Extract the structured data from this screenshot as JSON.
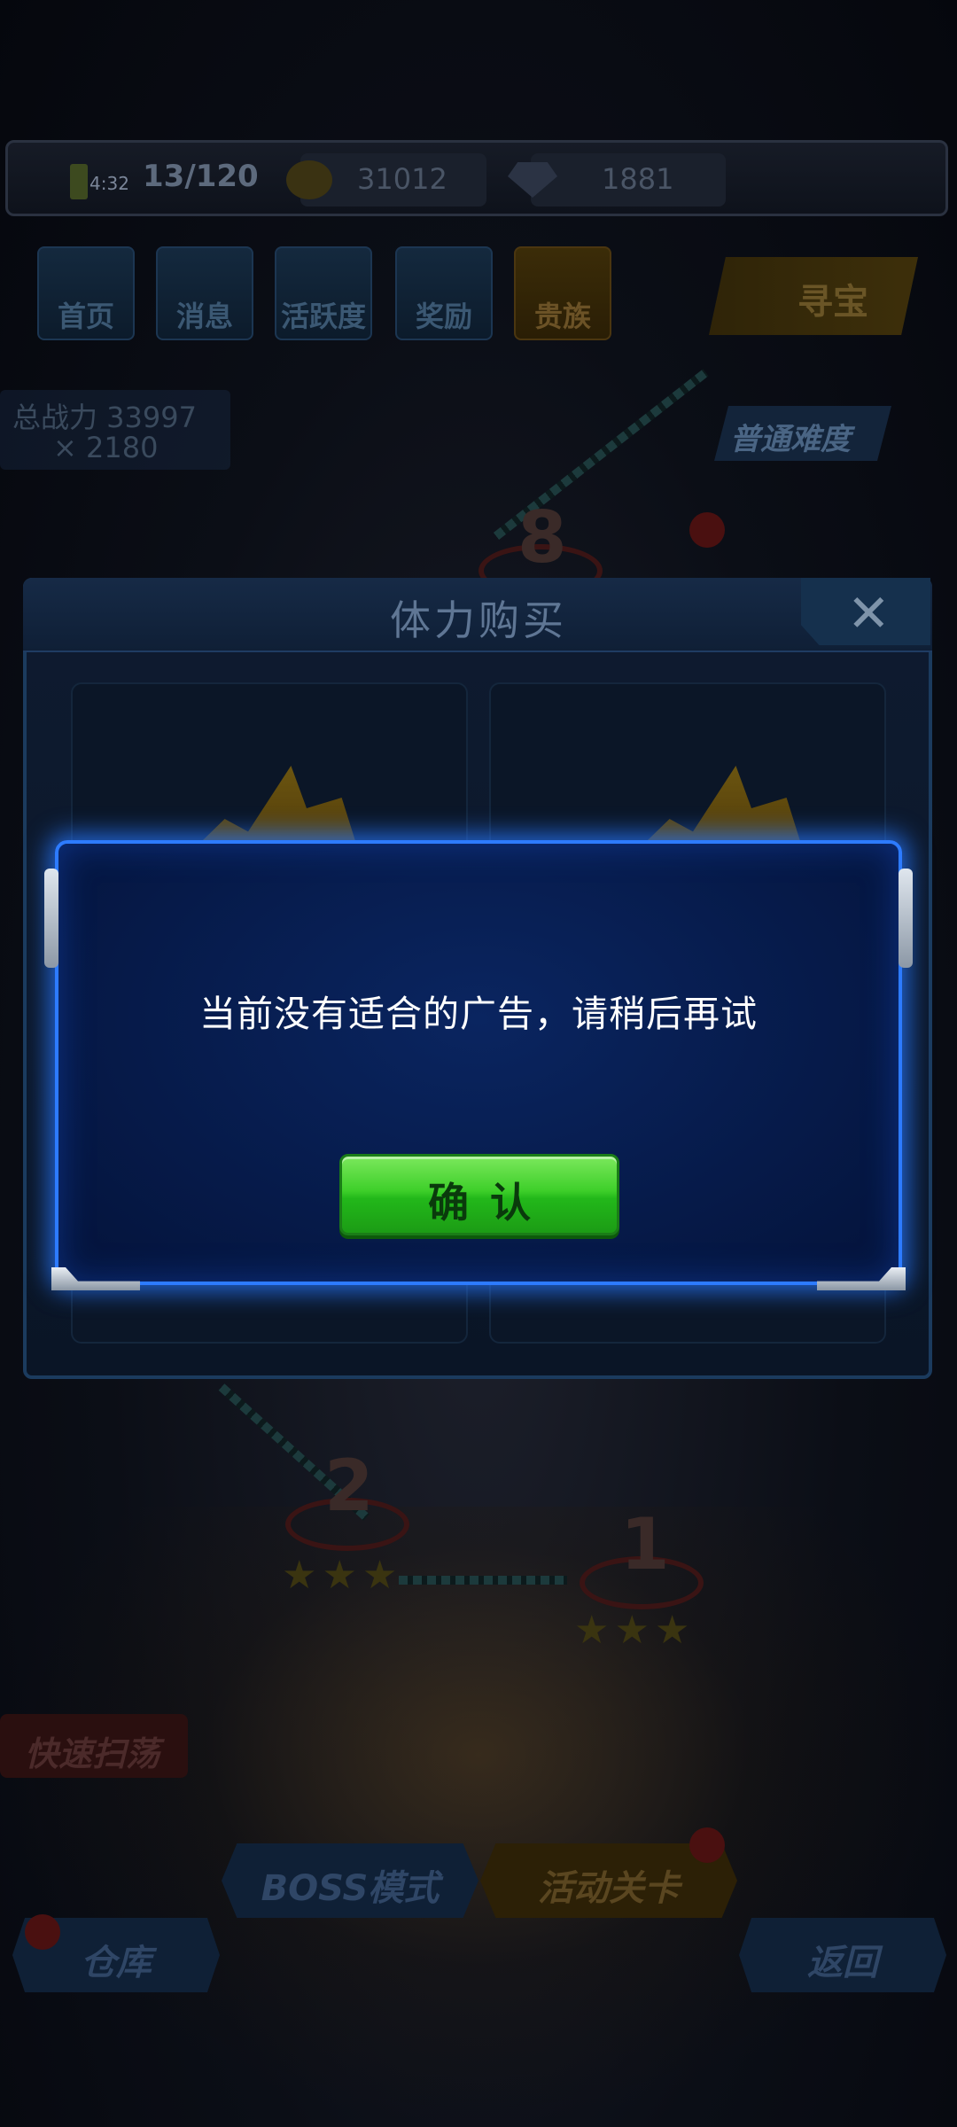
{
  "hud": {
    "time": "4:32",
    "stamina": "13/120",
    "gold": "31012",
    "diamonds": "1881"
  },
  "menu": {
    "items": [
      {
        "label": "首页"
      },
      {
        "label": "消息"
      },
      {
        "label": "活跃度"
      },
      {
        "label": "奖励"
      },
      {
        "label": "贵族"
      }
    ],
    "treasure_label": "寻宝"
  },
  "stats": {
    "total_power": "总战力 33997",
    "keys": "× 2180",
    "difficulty": "普通难度"
  },
  "stages": [
    {
      "number": "8"
    },
    {
      "number": "2"
    },
    {
      "number": "1"
    }
  ],
  "bottom": {
    "quick_sweep": "快速扫荡",
    "boss_mode": "BOSS模式",
    "event_stage": "活动关卡",
    "warehouse": "仓库",
    "back": "返回"
  },
  "purchase_panel": {
    "title": "体力购买",
    "close_icon": "close-icon"
  },
  "alert": {
    "message": "当前没有适合的广告，请稍后再试",
    "confirm_label": "确认"
  },
  "colors": {
    "dialog_border": "#2d7bff",
    "dialog_bg": "#061a49",
    "confirm_green": "#3ecf2a"
  }
}
